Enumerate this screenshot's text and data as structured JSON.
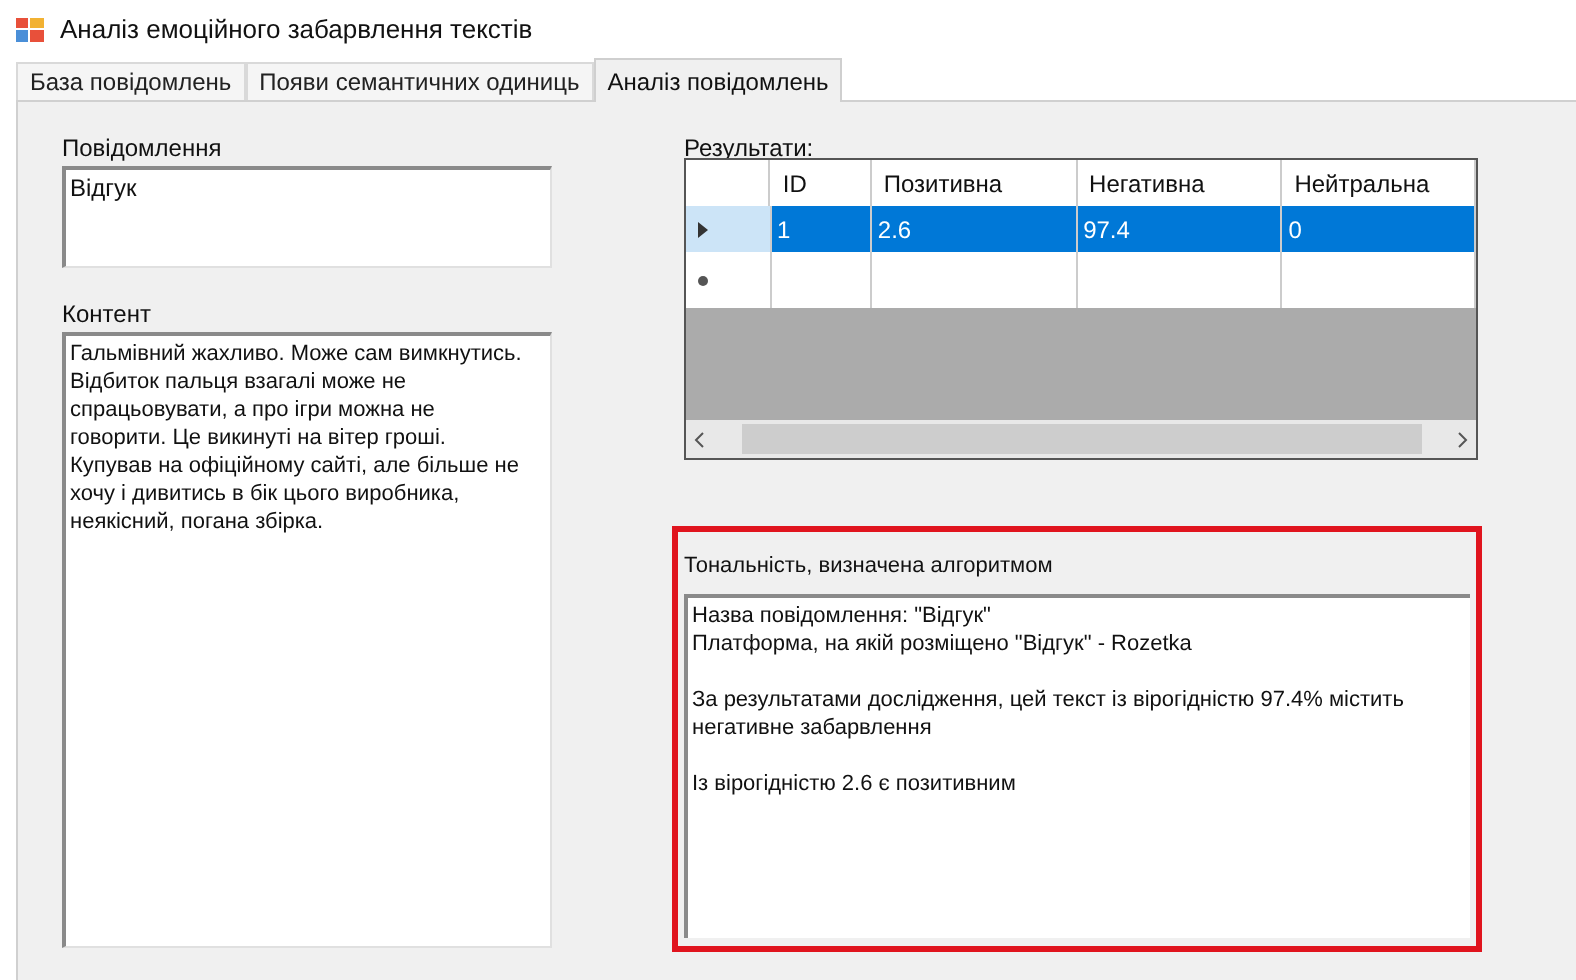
{
  "window": {
    "title": "Аналіз емоційного забарвлення текстів"
  },
  "tabs": [
    {
      "label": "База повідомлень",
      "selected": false
    },
    {
      "label": "Появи семантичних одиниць",
      "selected": false
    },
    {
      "label": "Аналіз повідомлень",
      "selected": true
    }
  ],
  "message": {
    "label": "Повідомлення",
    "value": "Відгук"
  },
  "content": {
    "label": "Контент",
    "value": "Гальмівний жахливо. Може сам вимкнутись.\nВідбиток пальця взагалі може не\nспрацьовувати, а про ігри можна не\nговорити. Це викинуті на вітер гроші.\nКупував на офіційному сайті, але більше не\nхочу і дивитись в бік цього виробника,\nнеякісний, погана збірка."
  },
  "results": {
    "label": "Результати:",
    "columns": [
      "ID",
      "Позитивна",
      "Негативна",
      "Нейтральна"
    ],
    "rows": [
      {
        "kind": "data",
        "selected": true,
        "cells": [
          "1",
          "2.6",
          "97.4",
          "0"
        ]
      },
      {
        "kind": "new",
        "selected": false,
        "cells": []
      }
    ]
  },
  "tonality": {
    "highlighted": true,
    "label": "Тональність, визначена алгоритмом",
    "value": "Назва повідомлення: \"Відгук\"\nПлатформа, на якій розміщено \"Відгук\" - Rozetka\n\nЗа результатами дослідження, цей текст із вірогідністю 97.4% містить\nнегативне забарвлення\n\nІз вірогідністю 2.6 є позитивним"
  }
}
